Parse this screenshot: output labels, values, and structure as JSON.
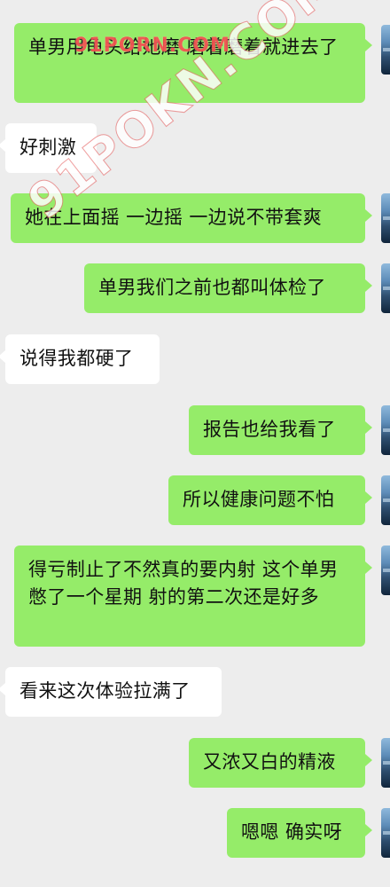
{
  "watermark": {
    "main": "91POKN.COM",
    "top": "91PORN.COM"
  },
  "messages": [
    {
      "id": 1,
      "side": "sent",
      "text": "单男用龟头给她磨 磨着磨着就进去了"
    },
    {
      "id": 2,
      "side": "received",
      "text": "好刺激"
    },
    {
      "id": 3,
      "side": "sent",
      "text": "她在上面摇 一边摇 一边说不带套爽"
    },
    {
      "id": 4,
      "side": "sent",
      "text": "单男我们之前也都叫体检了"
    },
    {
      "id": 5,
      "side": "received",
      "text": "说得我都硬了"
    },
    {
      "id": 6,
      "side": "sent",
      "text": "报告也给我看了"
    },
    {
      "id": 7,
      "side": "sent",
      "text": "所以健康问题不怕"
    },
    {
      "id": 8,
      "side": "sent",
      "text": "得亏制止了不然真的要内射 这个单男憋了一个星期 射的第二次还是好多"
    },
    {
      "id": 9,
      "side": "received",
      "text": "看来这次体验拉满了"
    },
    {
      "id": 10,
      "side": "sent",
      "text": "又浓又白的精液"
    },
    {
      "id": 11,
      "side": "sent",
      "text": "嗯嗯 确实呀"
    }
  ],
  "colors": {
    "background": "#ededed",
    "sent_bubble": "#95ec69",
    "received_bubble": "#ffffff",
    "text": "#111111",
    "watermark": "#e64646"
  },
  "icons": {
    "avatar": "avatar-image-icon"
  }
}
